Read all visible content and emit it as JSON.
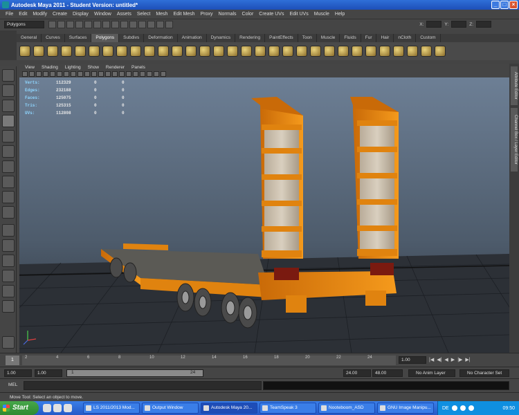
{
  "window": {
    "title": "Autodesk Maya 2011 - Student Version: untitled*"
  },
  "menu": [
    "File",
    "Edit",
    "Modify",
    "Create",
    "Display",
    "Window",
    "Assets",
    "Select",
    "Mesh",
    "Edit Mesh",
    "Proxy",
    "Normals",
    "Color",
    "Create UVs",
    "Edit UVs",
    "Muscle",
    "Help"
  ],
  "status": {
    "mode": "Polygons",
    "x_label": "X:",
    "y_label": "Y:",
    "z_label": "Z:"
  },
  "shelf_tabs": [
    "General",
    "Curves",
    "Surfaces",
    "Polygons",
    "Subdivs",
    "Deformation",
    "Animation",
    "Dynamics",
    "Rendering",
    "PaintEffects",
    "Toon",
    "Muscle",
    "Fluids",
    "Fur",
    "Hair",
    "nCloth",
    "Custom"
  ],
  "shelf_active": "Polygons",
  "panel_menu": [
    "View",
    "Shading",
    "Lighting",
    "Show",
    "Renderer",
    "Panels"
  ],
  "hud": [
    {
      "label": "Verts:",
      "v1": "112329",
      "v2": "0",
      "v3": "0"
    },
    {
      "label": "Edges:",
      "v1": "232188",
      "v2": "0",
      "v3": "0"
    },
    {
      "label": "Faces:",
      "v1": "125075",
      "v2": "0",
      "v3": "0"
    },
    {
      "label": "Tris:",
      "v1": "125315",
      "v2": "0",
      "v3": "0"
    },
    {
      "label": "UVs:",
      "v1": "112808",
      "v2": "0",
      "v3": "0"
    }
  ],
  "side_tabs": [
    "Attribute Editor",
    "Channel Box / Layer Editor"
  ],
  "timeline": {
    "current_frame": "1",
    "ticks": [
      "2",
      "4",
      "6",
      "8",
      "10",
      "12",
      "14",
      "16",
      "18",
      "20",
      "22",
      "24"
    ],
    "frame_field": "1.00"
  },
  "range": {
    "start": "1.00",
    "anim_start": "1.00",
    "slider_start": "1",
    "slider_end": "24",
    "anim_end": "24.00",
    "end": "48.00",
    "anim_layer": "No Anim Layer",
    "char_set": "No Character Set"
  },
  "mel": {
    "label": "MEL"
  },
  "help_line": "Move Tool: Select an object to move.",
  "taskbar": {
    "start": "Start",
    "tasks": [
      "LS 2011/2013 Mod...",
      "Output Window",
      "Autodesk Maya 20...",
      "TeamSpeak 3",
      "Nooteboom_ASD",
      "GNU Image Manipu..."
    ],
    "lang": "DE",
    "clock": "09:50"
  },
  "colors": {
    "trailer_orange": "#f08a10",
    "viewport_top": "#6d7f95",
    "taskbar_blue": "#2459c8"
  }
}
